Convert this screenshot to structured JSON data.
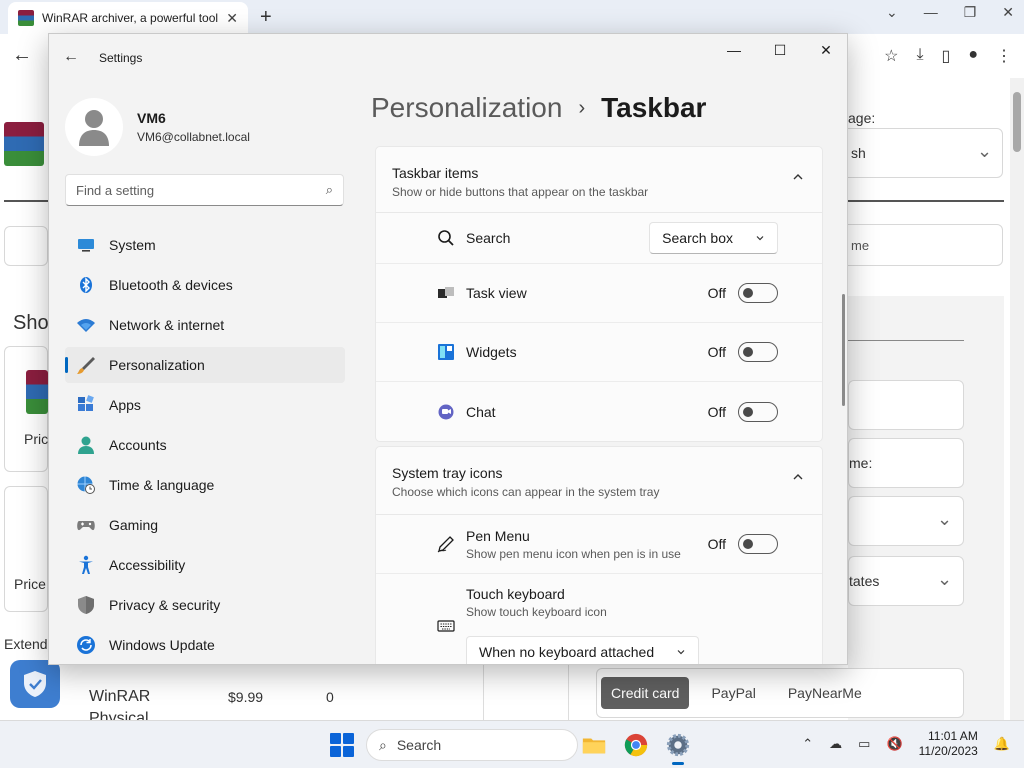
{
  "browser": {
    "tab_title": "WinRAR archiver, a powerful tool",
    "tab_close": "✕",
    "new_tab": "+",
    "page": {
      "language_label": "age:",
      "language_value": "sh",
      "name_placeholder": "me",
      "section_shop": "Sho",
      "price_1": "Pric",
      "price_2": "Price",
      "ext_label": "Extend",
      "product_name": "WinRAR",
      "product_name_2": "Physical",
      "product_price": "$9.99",
      "product_qty": "0",
      "right_name_label": "me:",
      "right_states": "tates",
      "payments": [
        "Credit card",
        "PayPal",
        "PayNearMe"
      ]
    }
  },
  "settings": {
    "window_title": "Settings",
    "profile": {
      "name": "VM6",
      "email": "VM6@collabnet.local"
    },
    "search_placeholder": "Find a setting",
    "nav": [
      {
        "label": "System",
        "icon": "monitor-icon"
      },
      {
        "label": "Bluetooth & devices",
        "icon": "bluetooth-icon"
      },
      {
        "label": "Network & internet",
        "icon": "wifi-icon"
      },
      {
        "label": "Personalization",
        "icon": "paintbrush-icon",
        "active": true
      },
      {
        "label": "Apps",
        "icon": "apps-icon"
      },
      {
        "label": "Accounts",
        "icon": "person-icon"
      },
      {
        "label": "Time & language",
        "icon": "globe-clock-icon"
      },
      {
        "label": "Gaming",
        "icon": "gamepad-icon"
      },
      {
        "label": "Accessibility",
        "icon": "accessibility-icon"
      },
      {
        "label": "Privacy & security",
        "icon": "shield-icon"
      },
      {
        "label": "Windows Update",
        "icon": "update-icon"
      }
    ],
    "breadcrumb": {
      "parent": "Personalization",
      "separator": "›",
      "current": "Taskbar"
    },
    "taskbar_items": {
      "title": "Taskbar items",
      "subtitle": "Show or hide buttons that appear on the taskbar",
      "search": {
        "label": "Search",
        "value": "Search box"
      },
      "task_view": {
        "label": "Task view",
        "state": "Off"
      },
      "widgets": {
        "label": "Widgets",
        "state": "Off"
      },
      "chat": {
        "label": "Chat",
        "state": "Off"
      }
    },
    "system_tray": {
      "title": "System tray icons",
      "subtitle": "Choose which icons can appear in the system tray",
      "pen_menu": {
        "label": "Pen Menu",
        "sub": "Show pen menu icon when pen is in use",
        "state": "Off"
      },
      "touch_keyboard": {
        "label": "Touch keyboard",
        "sub": "Show touch keyboard icon",
        "value": "When no keyboard attached"
      }
    }
  },
  "taskbar": {
    "search_label": "Search",
    "time": "11:01 AM",
    "date": "11/20/2023"
  },
  "colors": {
    "accent": "#0067c0",
    "settings_bg": "#f3f3f3",
    "card_bg": "#fbfbfb"
  }
}
